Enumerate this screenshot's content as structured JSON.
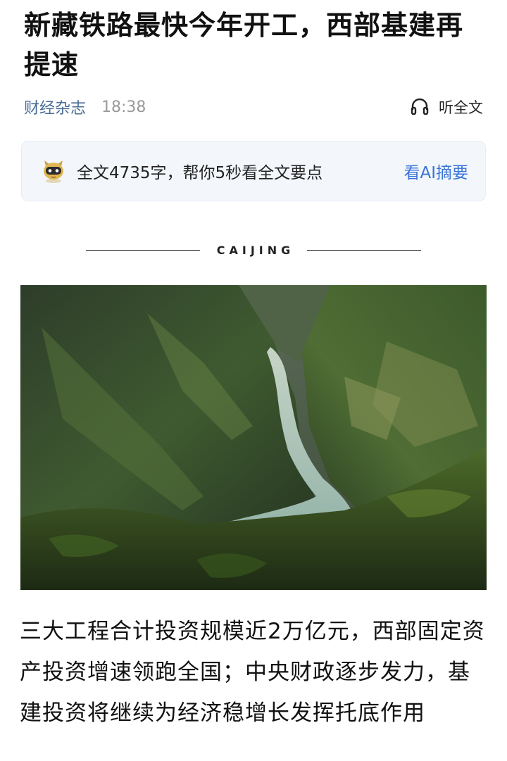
{
  "article": {
    "title": "新藏铁路最快今年开工，西部基建再提速",
    "source": "财经杂志",
    "time": "18:38",
    "listen_label": "听全文"
  },
  "ai_summary": {
    "text": "全文4735字，帮你5秒看全文要点",
    "link_label": "看AI摘要",
    "link_color": "#3a73d6"
  },
  "brand_divider": {
    "text": "CAIJING"
  },
  "lead_paragraph": "三大工程合计投资规模近2万亿元，西部固定资产投资增速领跑全国；中央财政逐步发力，基建投资将继续为经济稳增长发挥托底作用",
  "colors": {
    "source_link": "#4a6c96",
    "time_text": "#999999",
    "ai_box_bg": "#f3f7fc"
  },
  "icons": {
    "listen": "headphones-icon",
    "ai": "ai-robot-avatar-icon"
  }
}
